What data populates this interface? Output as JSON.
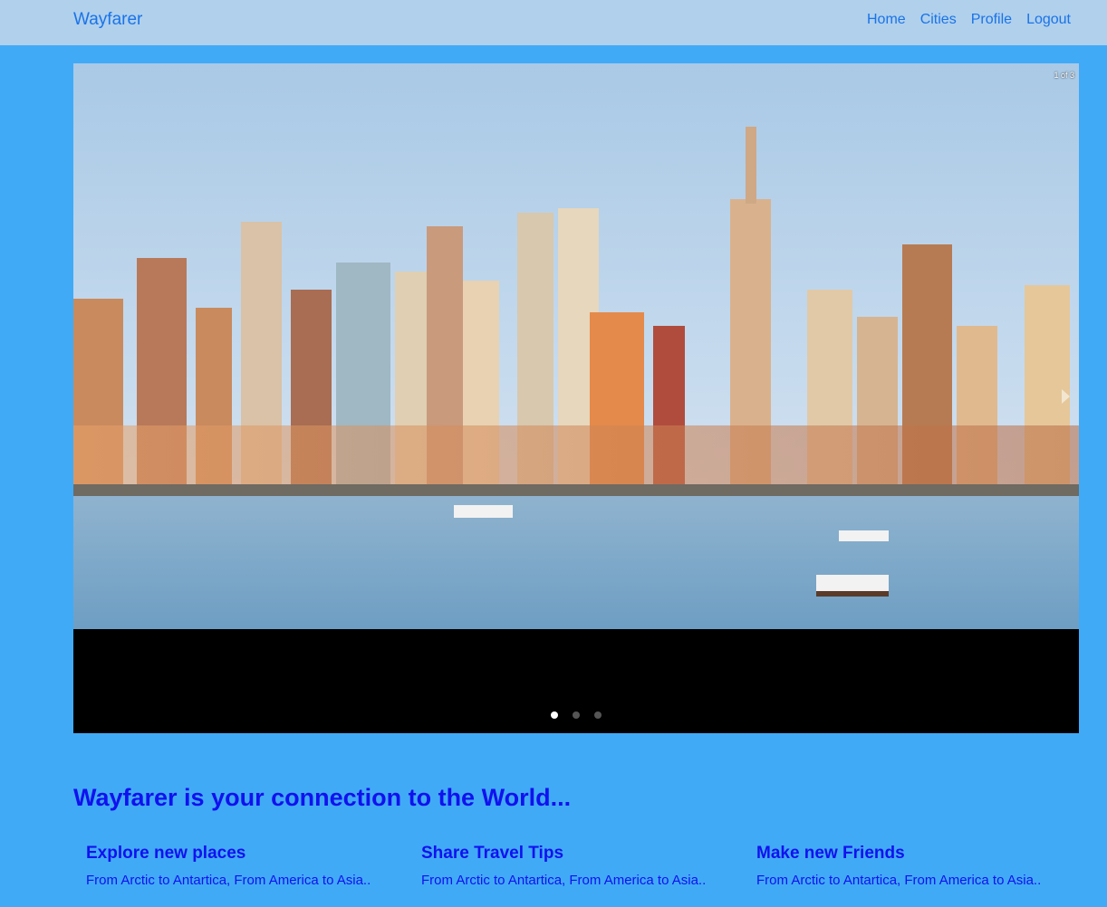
{
  "navbar": {
    "brand": "Wayfarer",
    "links": [
      "Home",
      "Cities",
      "Profile",
      "Logout"
    ]
  },
  "carousel": {
    "counter": "1 of 3",
    "slides": 3,
    "active_index": 0,
    "image_alt": "New York City skyline across the river"
  },
  "main": {
    "tagline": "Wayfarer is your connection to the World...",
    "features": [
      {
        "title": "Explore new places",
        "text": "From Arctic to Antartica, From America to Asia.."
      },
      {
        "title": "Share Travel Tips",
        "text": "From Arctic to Antartica, From America to Asia.."
      },
      {
        "title": "Make new Friends",
        "text": "From Arctic to Antartica, From America to Asia.."
      }
    ]
  },
  "colors": {
    "page_background": "#41aaf7",
    "navbar_background": "#b0d0ec",
    "link": "#1a73e8",
    "heading": "#1111ee"
  },
  "icons": [
    "next-arrow-icon"
  ]
}
